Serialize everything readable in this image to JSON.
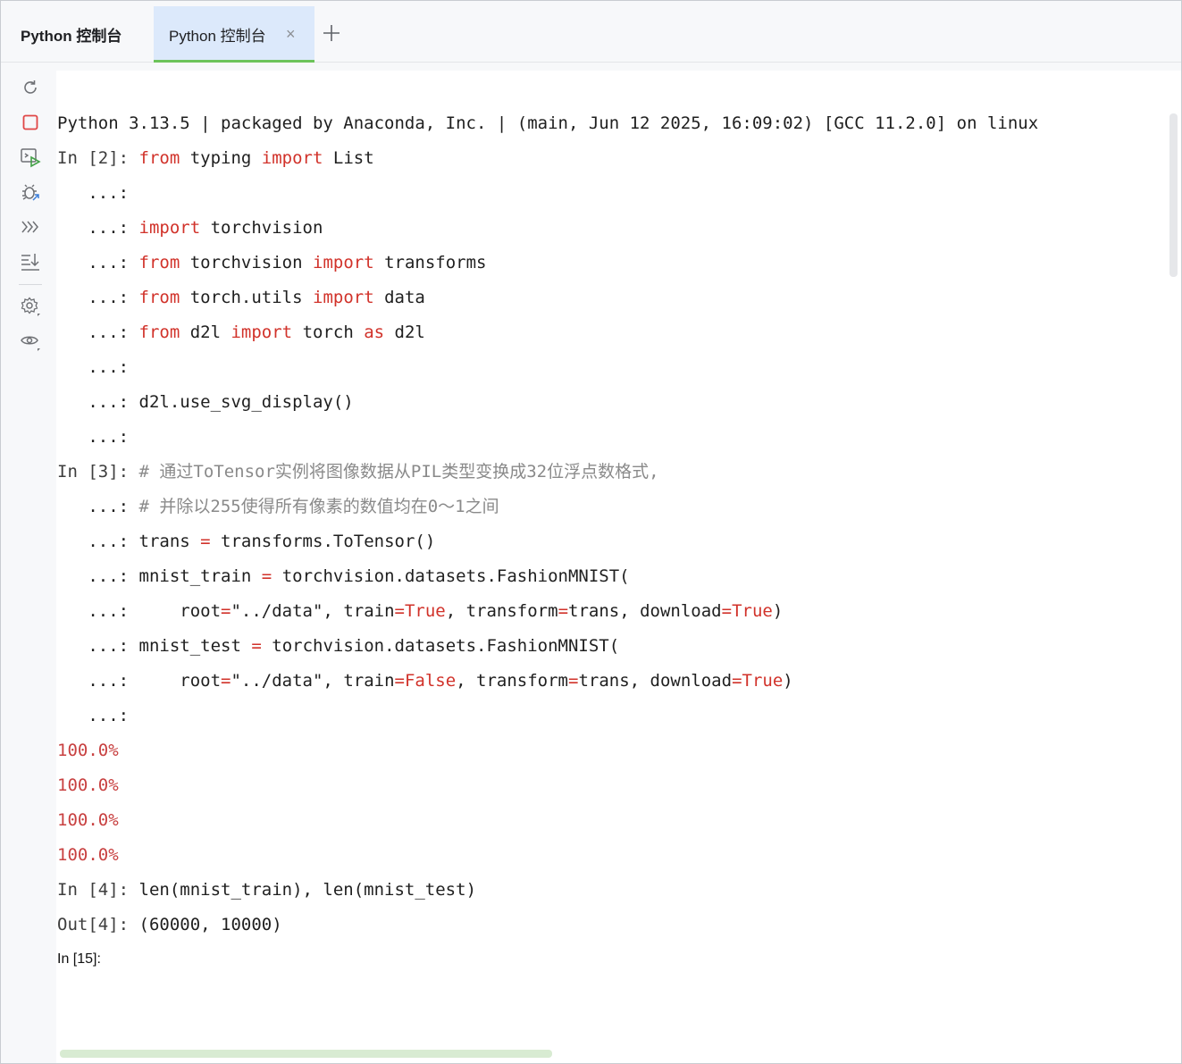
{
  "tabs": [
    {
      "label": "Python 控制台"
    },
    {
      "label": "Python 控制台",
      "close": "×"
    }
  ],
  "add_tab_label": "+",
  "toolbar": {
    "icons": [
      "rerun-icon",
      "stop-icon",
      "execute-icon",
      "debug-icon",
      "history-icon",
      "scroll-to-end-icon",
      "settings-icon",
      "view-icon"
    ]
  },
  "console": {
    "banner": "Python 3.13.5 | packaged by Anaconda, Inc. | (main, Jun 12 2025, 16:09:02) [GCC 11.2.0] on linux",
    "prompts": {
      "in2": "In [2]: ",
      "in3": "In [3]: ",
      "in4": "In [4]: ",
      "out4": "Out[4]: ",
      "in15": "In [15]:",
      "cont": "   ...: "
    },
    "code": {
      "l1": {
        "a": "from",
        "b": " typing ",
        "c": "import",
        "d": " List"
      },
      "l3": {
        "a": "import",
        "b": " torchvision"
      },
      "l4": {
        "a": "from",
        "b": " torchvision ",
        "c": "import",
        "d": " transforms"
      },
      "l5": {
        "a": "from",
        "b": " torch.utils ",
        "c": "import",
        "d": " data"
      },
      "l6": {
        "a": "from",
        "b": " d2l ",
        "c": "import",
        "d": " torch ",
        "e": "as",
        "f": " d2l"
      },
      "l8": "d2l.use_svg_display()",
      "c1": "# 通过ToTensor实例将图像数据从PIL类型变换成32位浮点数格式,",
      "c2": "# 并除以255使得所有像素的数值均在0～1之间",
      "t1": {
        "a": "trans ",
        "b": "=",
        "c": " transforms.ToTensor()"
      },
      "t2": {
        "a": "mnist_train ",
        "b": "=",
        "c": " torchvision.datasets.FashionMNIST("
      },
      "t3": {
        "a": "    root",
        "b": "=",
        "c": "\"../data\", train",
        "d": "=",
        "e": "True",
        "f": ", transform",
        "g": "=",
        "h": "trans, download",
        "i": "=",
        "j": "True",
        "k": ")"
      },
      "t4": {
        "a": "mnist_test ",
        "b": "=",
        "c": " torchvision.datasets.FashionMNIST("
      },
      "t5": {
        "a": "    root",
        "b": "=",
        "c": "\"../data\", train",
        "d": "=",
        "e": "False",
        "f": ", transform",
        "g": "=",
        "h": "trans, download",
        "i": "=",
        "j": "True",
        "k": ")"
      },
      "len": "len(mnist_train), len(mnist_test)",
      "out": "(60000, 10000)"
    },
    "progress": [
      "100.0%",
      "100.0%",
      "100.0%",
      "100.0%"
    ]
  }
}
